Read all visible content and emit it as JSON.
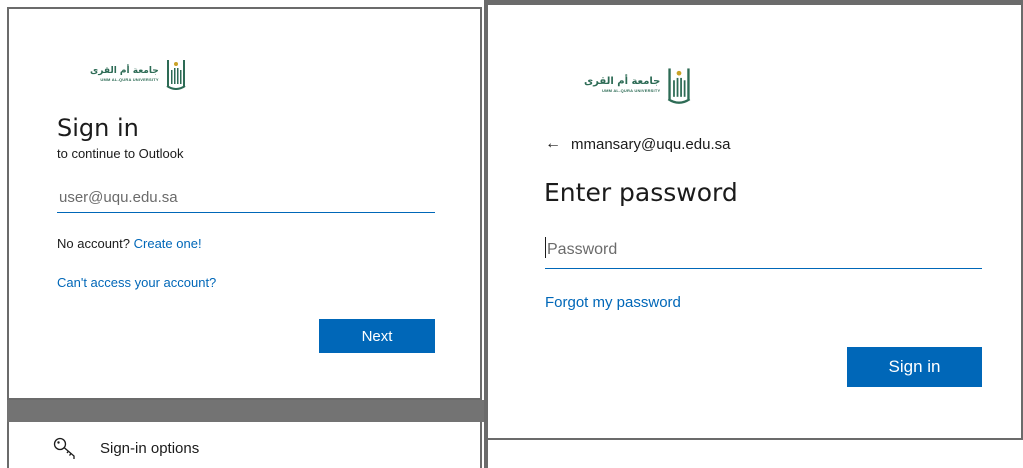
{
  "left": {
    "logo": {
      "arabic": "جامعة أم القرى",
      "english": "UMM AL-QURA UNIVERSITY"
    },
    "title": "Sign in",
    "subtitle": "to continue to Outlook",
    "email_placeholder": "user@uqu.edu.sa",
    "no_account_text": "No account?",
    "create_link": "Create one!",
    "cant_access_link": "Can't access your account?",
    "next_label": "Next",
    "signin_options_label": "Sign-in options",
    "signin_options_icon": "key-icon"
  },
  "right": {
    "logo": {
      "arabic": "جامعة أم القرى",
      "english": "UMM AL-QURA UNIVERSITY"
    },
    "back_icon": "arrow-left-icon",
    "email": "mmansary@uqu.edu.sa",
    "title": "Enter password",
    "password_placeholder": "Password",
    "forgot_link": "Forgot my password",
    "signin_label": "Sign in"
  },
  "colors": {
    "accent": "#0067b8",
    "logo_green": "#2d6b55",
    "frame_gray": "#6b6b6b"
  }
}
